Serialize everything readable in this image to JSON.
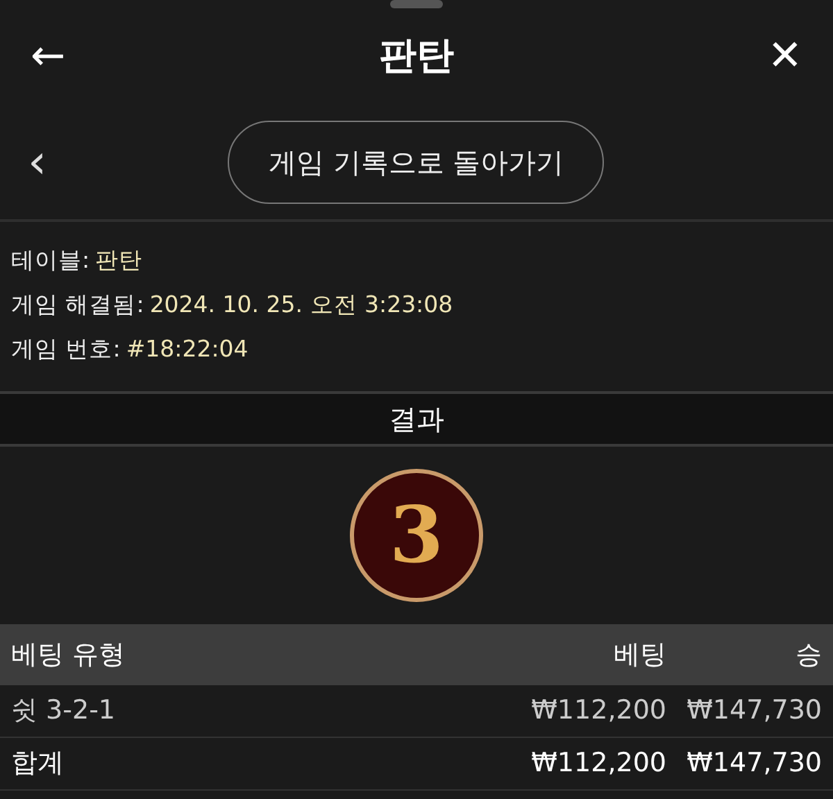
{
  "header": {
    "title": "판탄",
    "back_icon": "←",
    "close_icon": "✕"
  },
  "nav": {
    "chevron": "‹",
    "button": "게임 기록으로 돌아가기"
  },
  "info": [
    {
      "label": "테이블:",
      "value": "판탄"
    },
    {
      "label": "게임 해결됨:",
      "value": "2024. 10. 25. 오전 3:23:08"
    },
    {
      "label": "게임 번호:",
      "value": "#18:22:04"
    }
  ],
  "result": {
    "title": "결과",
    "number": "3"
  },
  "table": {
    "columns": [
      "베팅 유형",
      "베팅",
      "승"
    ],
    "rows": [
      {
        "kind": "item",
        "cells": [
          "쉿 3-2-1",
          "₩112,200",
          "₩147,730"
        ]
      },
      {
        "kind": "total",
        "cells": [
          "합계",
          "₩112,200",
          "₩147,730"
        ]
      }
    ]
  }
}
